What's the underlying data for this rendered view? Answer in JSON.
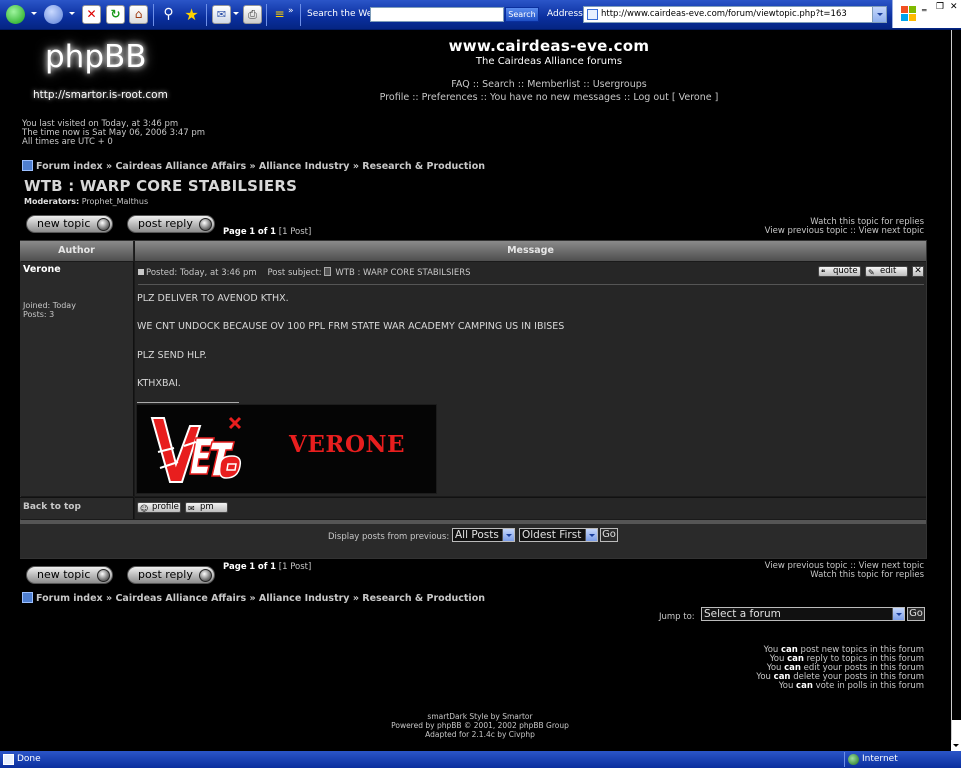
{
  "browser": {
    "search_label": "Search the Web",
    "search_button": "Search",
    "address_label": "Address",
    "url": "http://www.cairdeas-eve.com/forum/viewtopic.php?t=163",
    "status_text": "Done",
    "status_zone": "Internet"
  },
  "header": {
    "logo_text": "phpBB",
    "logo_url": "http://smartor.is-root.com",
    "site_title": "www.cairdeas-eve.com",
    "site_description": "The Cairdeas Alliance forums",
    "nav": {
      "faq": "FAQ",
      "search": "Search",
      "memberlist": "Memberlist",
      "usergroups": "Usergroups",
      "profile": "Profile",
      "preferences": "Preferences",
      "messages": "You have no new messages",
      "logout": "Log out [ Verone ]"
    }
  },
  "visit_info": {
    "last_visit": "You last visited on Today, at 3:46 pm",
    "time_now": "The time now is Sat May 06, 2006 3:47 pm",
    "timezone": "All times are UTC + 0"
  },
  "breadcrumb": {
    "items": [
      "Forum index",
      "Cairdeas Alliance Affairs",
      "Alliance Industry",
      "Research & Production"
    ],
    "separator": "»"
  },
  "topic": {
    "title": "WTB : WARP CORE STABILSIERS",
    "moderators_label": "Moderators:",
    "moderator": "Prophet_Malthus"
  },
  "buttons": {
    "new_topic": "new topic",
    "post_reply": "post reply",
    "quote": "quote",
    "edit": "edit",
    "delete": "✕",
    "profile": "profile",
    "pm": "pm",
    "go": "Go"
  },
  "pagination": {
    "page_word": "Page",
    "current": "1",
    "of_word": "of",
    "total": "1",
    "count": "[1 Post]"
  },
  "topic_links": {
    "watch": "Watch this topic for replies",
    "previous": "View previous topic",
    "sep": "::",
    "next": "View next topic"
  },
  "table_headers": {
    "author": "Author",
    "message": "Message"
  },
  "post": {
    "author": "Verone",
    "joined": "Joined: Today",
    "posts": "Posts: 3",
    "posted_label": "Posted: Today, at 3:46 pm",
    "subject_label": "Post subject:",
    "subject": "WTB : WARP CORE STABILSIERS",
    "lines": [
      "PLZ DELIVER TO AVENOD KTHX.",
      "WE CNT UNDOCK BECAUSE OV 100 PPL FRM STATE WAR ACADEMY CAMPING US IN IBISES",
      "PLZ SEND HLP.",
      "KTHXBAI."
    ],
    "signature_name": "VERONE",
    "back_to_top": "Back to top"
  },
  "filter": {
    "label": "Display posts from previous:",
    "period": "All Posts",
    "order": "Oldest First"
  },
  "jump": {
    "label": "Jump to:",
    "placeholder": "Select a forum"
  },
  "permissions": [
    {
      "pre": "You",
      "can": "can",
      "post": "post new topics in this forum"
    },
    {
      "pre": "You",
      "can": "can",
      "post": "reply to topics in this forum"
    },
    {
      "pre": "You",
      "can": "can",
      "post": "edit your posts in this forum"
    },
    {
      "pre": "You",
      "can": "can",
      "post": "delete your posts in this forum"
    },
    {
      "pre": "You",
      "can": "can",
      "post": "vote in polls in this forum"
    }
  ],
  "footer": {
    "style": "smartDark Style by Smartor",
    "powered": "Powered by phpBB © 2001, 2002 phpBB Group",
    "adapted": "Adapted for 2.1.4c by Civphp"
  },
  "colors": {
    "signature_red": "#e81e1e",
    "page_bg": "#000000",
    "toolbar_blue": "#0a2f9e"
  }
}
